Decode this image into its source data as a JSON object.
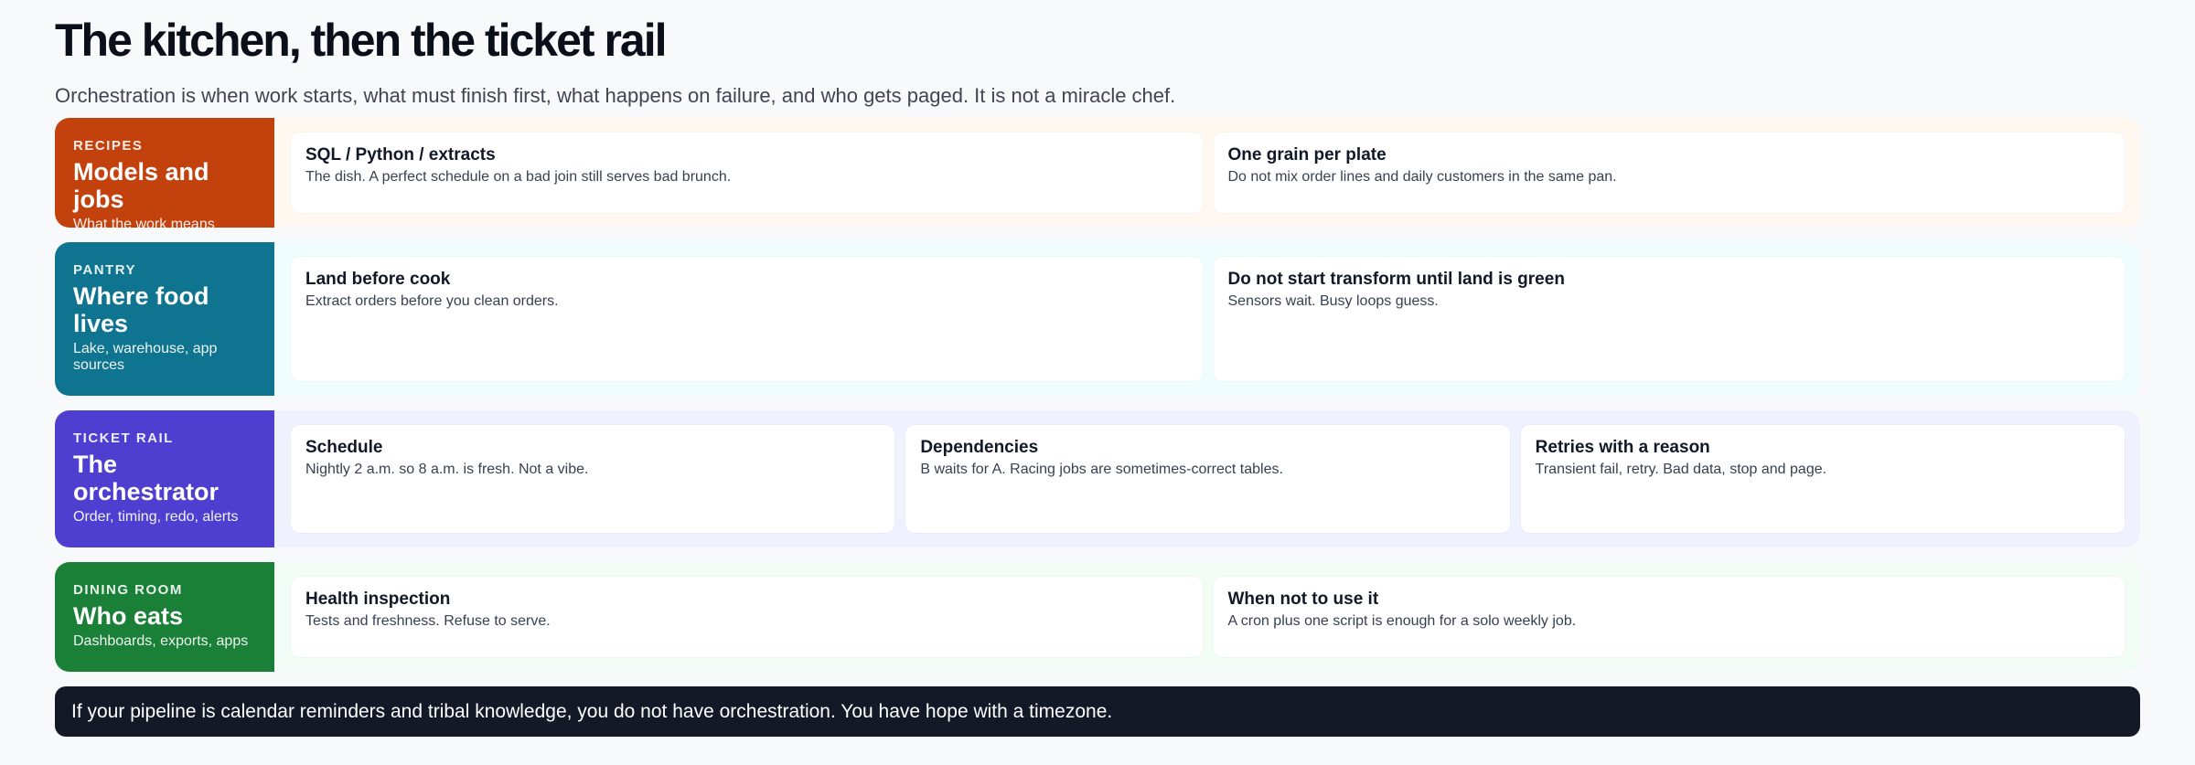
{
  "title": "The kitchen, then the ticket rail",
  "subtitle": "Orchestration is when work starts, what must finish first, what happens on failure, and who gets paged. It is not a miracle chef.",
  "layers": [
    {
      "kicker": "RECIPES",
      "name": "Models and jobs",
      "desc": "What the work means",
      "accent": "#c2410c",
      "tint": "#fff8f1",
      "cards": [
        {
          "title": "SQL / Python / extracts",
          "body": "The dish. A perfect schedule on a bad join still serves bad brunch."
        },
        {
          "title": "One grain per plate",
          "body": "Do not mix order lines and daily customers in the same pan."
        }
      ]
    },
    {
      "kicker": "PANTRY",
      "name": "Where food lives",
      "desc": "Lake, warehouse, app sources",
      "accent": "#0e7490",
      "tint": "#f0fdff",
      "cards": [
        {
          "title": "Land before cook",
          "body": "Extract orders before you clean orders."
        },
        {
          "title": "Do not start transform until land is green",
          "body": "Sensors wait. Busy loops guess."
        }
      ]
    },
    {
      "kicker": "TICKET RAIL",
      "name": "The orchestrator",
      "desc": "Order, timing, redo, alerts",
      "accent": "#4f3fd0",
      "tint": "#eff1fe",
      "cards": [
        {
          "title": "Schedule",
          "body": "Nightly 2 a.m. so 8 a.m. is fresh. Not a vibe."
        },
        {
          "title": "Dependencies",
          "body": "B waits for A. Racing jobs are sometimes-correct tables."
        },
        {
          "title": "Retries with a reason",
          "body": "Transient fail, retry. Bad data, stop and page."
        }
      ]
    },
    {
      "kicker": "DINING ROOM",
      "name": "Who eats",
      "desc": "Dashboards, exports, apps",
      "accent": "#1a8038",
      "tint": "#f1fdf4",
      "cards": [
        {
          "title": "Health inspection",
          "body": "Tests and freshness. Refuse to serve."
        },
        {
          "title": "When not to use it",
          "body": "A cron plus one script is enough for a solo weekly job."
        }
      ]
    }
  ],
  "footer": "If your pipeline is calendar reminders and tribal knowledge, you do not have orchestration. You have hope with a timezone."
}
